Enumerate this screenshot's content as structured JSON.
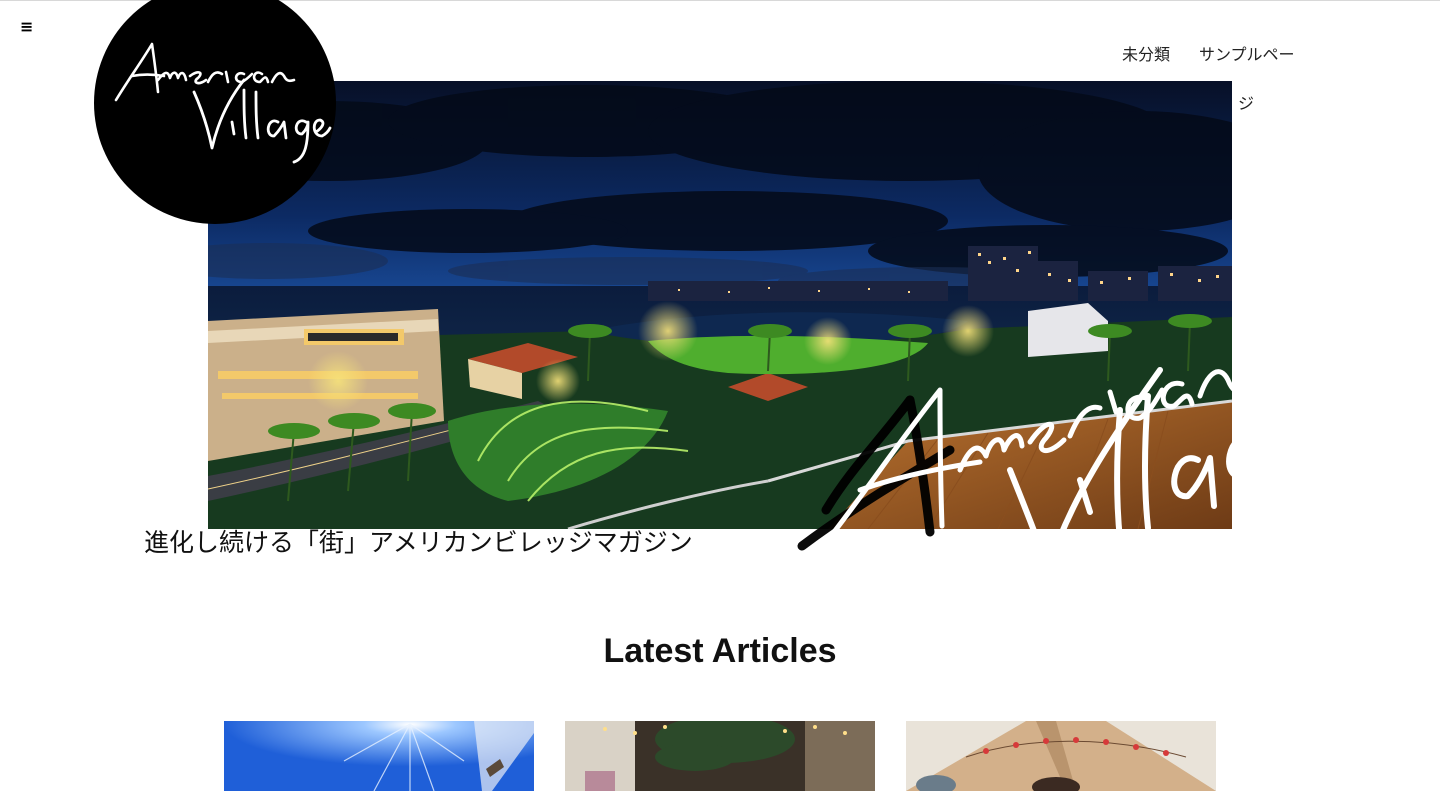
{
  "header": {
    "menu_icon": "hamburger-menu-icon",
    "logo": {
      "line1": "American",
      "line2": "Village"
    },
    "nav": {
      "items": [
        {
          "label": "未分類"
        },
        {
          "label": "サンプルペー",
          "wrap": "ジ"
        }
      ]
    }
  },
  "hero": {
    "image": "night-waterfront-cityscape",
    "overlay_logo": "American Village"
  },
  "tagline": "進化し続ける「街」アメリカンビレッジマガジン",
  "latest": {
    "title": "Latest Articles",
    "cards": [
      {
        "image": "blue-sky-sun-photo"
      },
      {
        "image": "cafe-interior-photo"
      },
      {
        "image": "tent-string-lights-photo"
      }
    ]
  },
  "colors": {
    "background": "#ffffff",
    "logo_bg": "#000000",
    "text": "#111111"
  }
}
